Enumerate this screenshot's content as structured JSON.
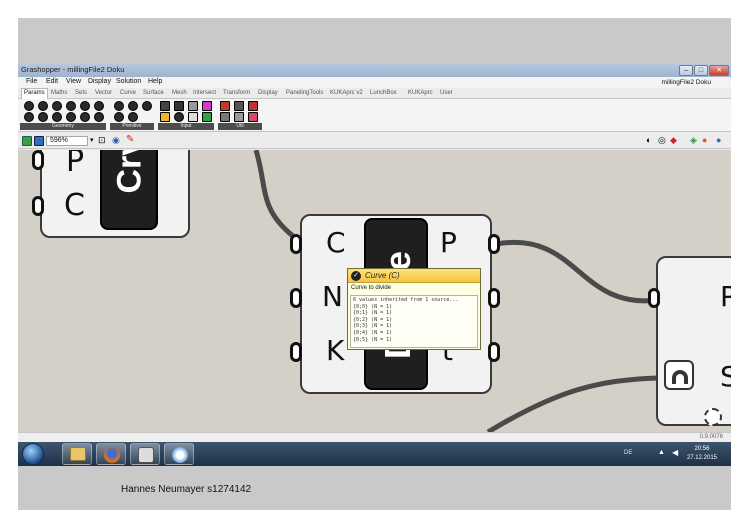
{
  "window": {
    "title": "Grashopper - millingFile2 Doku",
    "document_name": "millingFile2 Doku"
  },
  "menu": [
    "File",
    "Edit",
    "View",
    "Display",
    "Solution",
    "Help"
  ],
  "tabs": [
    {
      "label": "Params",
      "active": true
    },
    {
      "label": "Maths"
    },
    {
      "label": "Sets"
    },
    {
      "label": "Vector"
    },
    {
      "label": "Curve"
    },
    {
      "label": "Surface"
    },
    {
      "label": "Mesh"
    },
    {
      "label": "Intersect"
    },
    {
      "label": "Transform"
    },
    {
      "label": "Display"
    },
    {
      "label": "PanelingTools"
    },
    {
      "label": "KUKAprc v2"
    },
    {
      "label": "LunchBox"
    },
    {
      "label": "KUKAprc"
    },
    {
      "label": "User"
    }
  ],
  "ribbon_groups": [
    "Geometry",
    "Primitive",
    "Input",
    "Util"
  ],
  "canvas_toolbar": {
    "zoom": "596%"
  },
  "nodes": {
    "left": {
      "band_label": "Crv",
      "inputs": [
        "P",
        "C"
      ]
    },
    "divide": {
      "band_label": "Divide",
      "inputs": [
        "C",
        "N",
        "K"
      ],
      "outputs": [
        "P",
        "T",
        "t"
      ]
    },
    "right": {
      "inputs": [
        "P",
        "S"
      ]
    }
  },
  "tooltip": {
    "title": "Curve (C)",
    "description": "Curve to divide",
    "details": [
      "6 values inherited from 1 source...",
      "{0;0} (N = 1)",
      "{0;1} (N = 1)",
      "{0;2} (N = 1)",
      "{0;3} (N = 1)",
      "{0;4} (N = 1)",
      "{0;5} (N = 1)"
    ]
  },
  "status": {
    "version": "0.9.0076"
  },
  "taskbar": {
    "language": "DE",
    "time": "20:56",
    "date": "27.12.2015"
  },
  "caption": "Hannes Neumayer s1274142",
  "colors": {
    "canvas": "#d4d0c8",
    "wire": "#4a4a4a",
    "tooltip_header": "#f5c542",
    "taskbar": "#2b3f57"
  },
  "icons": [
    "grasshopper-icon",
    "firefox-icon",
    "explorer-icon",
    "rhino-icon",
    "start-orb-icon",
    "volume-icon",
    "network-icon"
  ]
}
